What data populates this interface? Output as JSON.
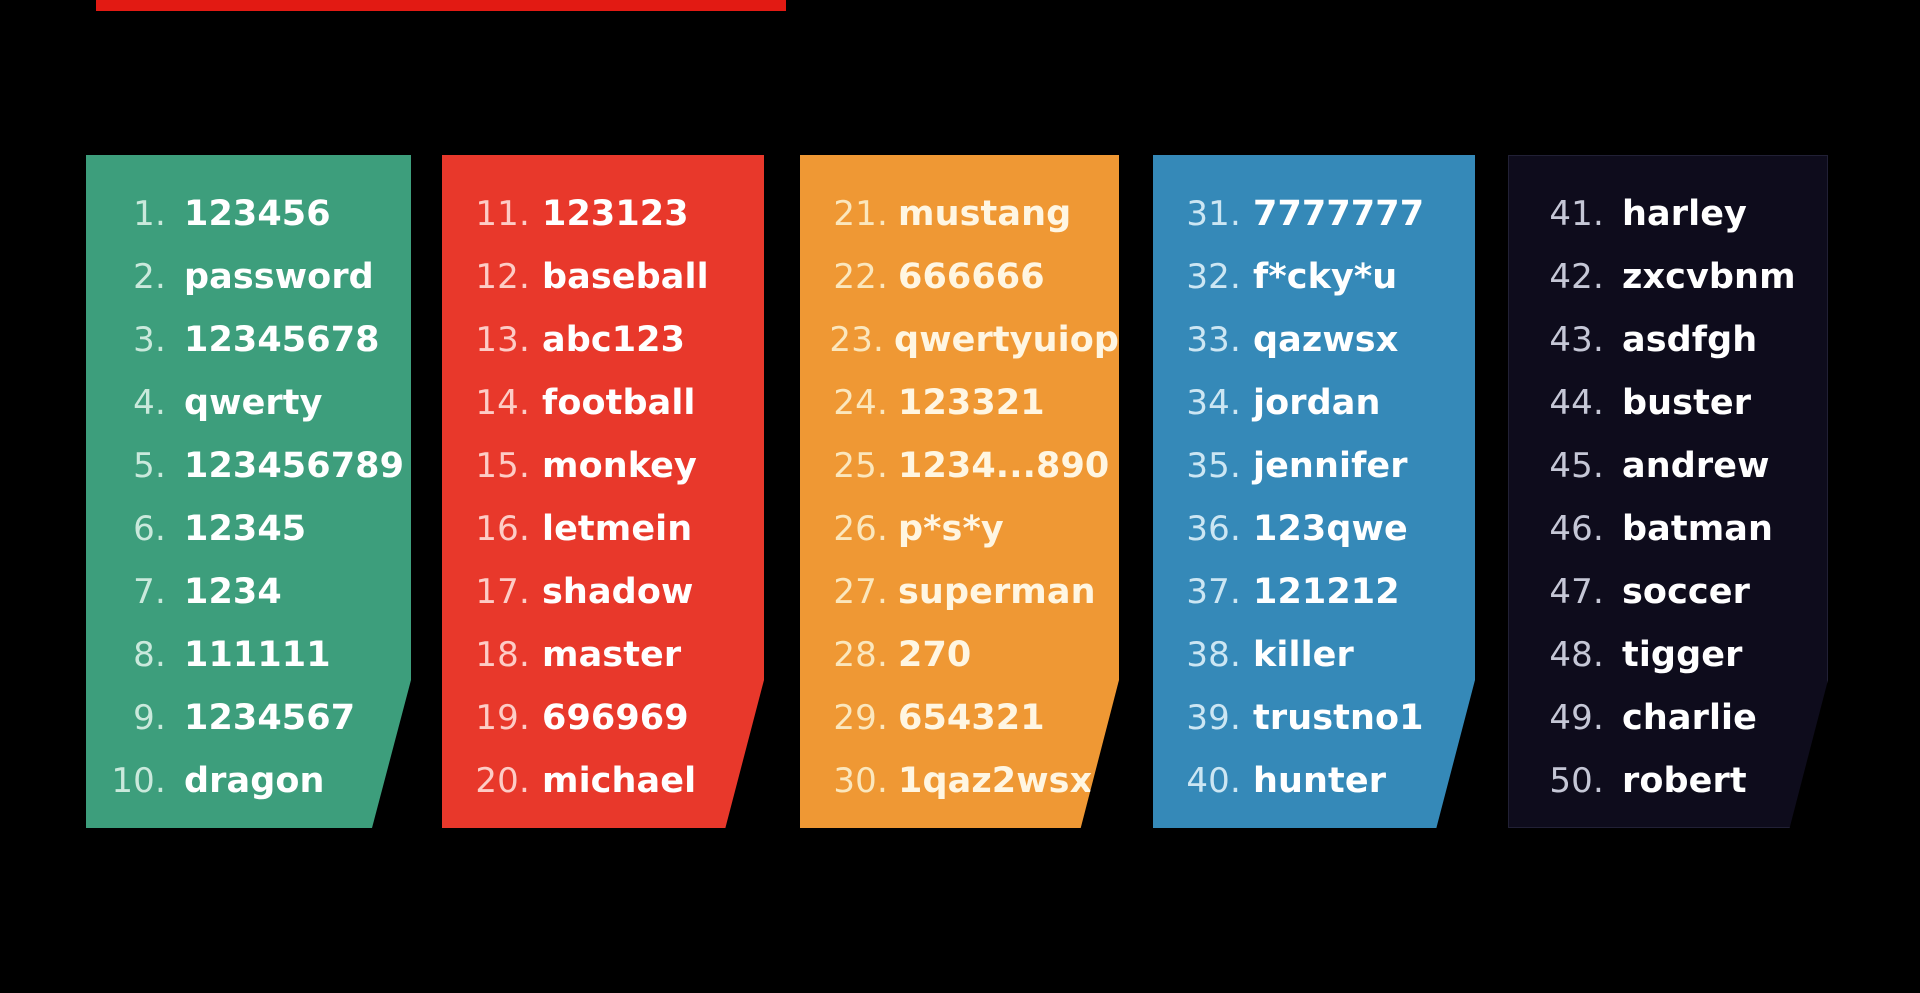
{
  "page": {
    "background_color": "#000000",
    "accent_rule_color": "#e21a13"
  },
  "cards": [
    {
      "name": "column-1",
      "color": "#3d9e7c",
      "text_color": "#ffffff",
      "entries": [
        {
          "rank": "1.",
          "password": "123456"
        },
        {
          "rank": "2.",
          "password": "password"
        },
        {
          "rank": "3.",
          "password": "12345678"
        },
        {
          "rank": "4.",
          "password": "qwerty"
        },
        {
          "rank": "5.",
          "password": "123456789"
        },
        {
          "rank": "6.",
          "password": "12345"
        },
        {
          "rank": "7.",
          "password": "1234"
        },
        {
          "rank": "8.",
          "password": "111111"
        },
        {
          "rank": "9.",
          "password": "1234567"
        },
        {
          "rank": "10.",
          "password": "dragon"
        }
      ]
    },
    {
      "name": "column-2",
      "color": "#e8382b",
      "text_color": "#ffffff",
      "entries": [
        {
          "rank": "11.",
          "password": "123123"
        },
        {
          "rank": "12.",
          "password": "baseball"
        },
        {
          "rank": "13.",
          "password": "abc123"
        },
        {
          "rank": "14.",
          "password": "football"
        },
        {
          "rank": "15.",
          "password": "monkey"
        },
        {
          "rank": "16.",
          "password": "letmein"
        },
        {
          "rank": "17.",
          "password": "shadow"
        },
        {
          "rank": "18.",
          "password": "master"
        },
        {
          "rank": "19.",
          "password": "696969"
        },
        {
          "rank": "20.",
          "password": "michael"
        }
      ]
    },
    {
      "name": "column-3",
      "color": "#ef9834",
      "text_color": "#fff6e2",
      "entries": [
        {
          "rank": "21.",
          "password": "mustang"
        },
        {
          "rank": "22.",
          "password": "666666"
        },
        {
          "rank": "23.",
          "password": "qwertyuiop"
        },
        {
          "rank": "24.",
          "password": "123321"
        },
        {
          "rank": "25.",
          "password": "1234...890"
        },
        {
          "rank": "26.",
          "password": "p*s*y"
        },
        {
          "rank": "27.",
          "password": "superman"
        },
        {
          "rank": "28.",
          "password": "270"
        },
        {
          "rank": "29.",
          "password": "654321"
        },
        {
          "rank": "30.",
          "password": "1qaz2wsx"
        }
      ]
    },
    {
      "name": "column-4",
      "color": "#3589b8",
      "text_color": "#ffffff",
      "entries": [
        {
          "rank": "31.",
          "password": "7777777"
        },
        {
          "rank": "32.",
          "password": "f*cky*u"
        },
        {
          "rank": "33.",
          "password": "qazwsx"
        },
        {
          "rank": "34.",
          "password": "jordan"
        },
        {
          "rank": "35.",
          "password": "jennifer"
        },
        {
          "rank": "36.",
          "password": "123qwe"
        },
        {
          "rank": "37.",
          "password": "121212"
        },
        {
          "rank": "38.",
          "password": "killer"
        },
        {
          "rank": "39.",
          "password": "trustno1"
        },
        {
          "rank": "40.",
          "password": "hunter"
        }
      ]
    },
    {
      "name": "column-5",
      "color": "#0e0c1c",
      "text_color": "#ffffff",
      "entries": [
        {
          "rank": "41.",
          "password": "harley"
        },
        {
          "rank": "42.",
          "password": "zxcvbnm"
        },
        {
          "rank": "43.",
          "password": "asdfgh"
        },
        {
          "rank": "44.",
          "password": "buster"
        },
        {
          "rank": "45.",
          "password": "andrew"
        },
        {
          "rank": "46.",
          "password": "batman"
        },
        {
          "rank": "47.",
          "password": "soccer"
        },
        {
          "rank": "48.",
          "password": "tigger"
        },
        {
          "rank": "49.",
          "password": "charlie"
        },
        {
          "rank": "50.",
          "password": "robert"
        }
      ]
    }
  ]
}
